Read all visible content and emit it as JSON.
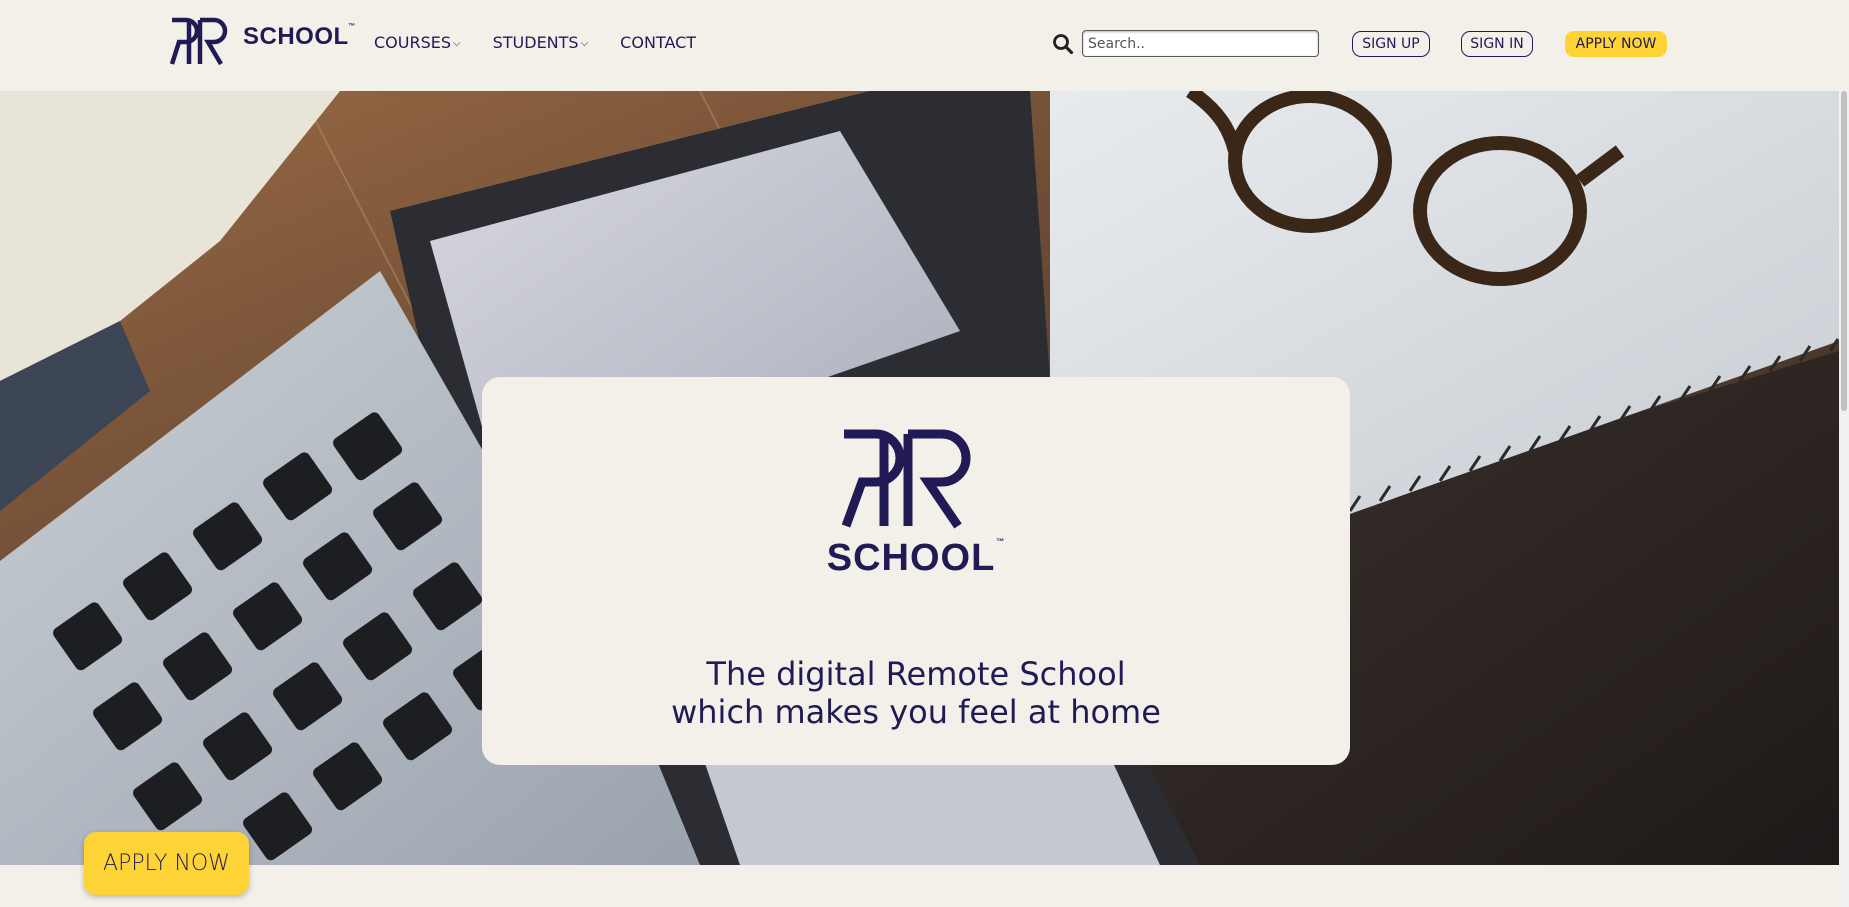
{
  "brand": {
    "logo_text": "SCHOOL",
    "trademark": "™"
  },
  "nav": {
    "items": [
      {
        "label": "COURSES",
        "has_dropdown": true,
        "chevron": "chevron-down-icon"
      },
      {
        "label": "STUDENTS",
        "has_dropdown": true,
        "chevron": "chevron-down-icon"
      },
      {
        "label": "CONTACT",
        "has_dropdown": false
      }
    ]
  },
  "search": {
    "placeholder": "Search..",
    "value": ""
  },
  "header_buttons": {
    "sign_up": "SIGN UP",
    "sign_in": "SIGN IN",
    "apply_now": "APPLY NOW"
  },
  "hero": {
    "card_logo_text": "SCHOOL",
    "card_trademark": "™",
    "tagline_line1": "The digital Remote School",
    "tagline_line2": "which makes you feel at home"
  },
  "floating_cta": {
    "label": "APPLY NOW"
  },
  "colors": {
    "brand_navy": "#211a55",
    "accent_yellow": "#fdd335",
    "background": "#f3f0ea"
  }
}
